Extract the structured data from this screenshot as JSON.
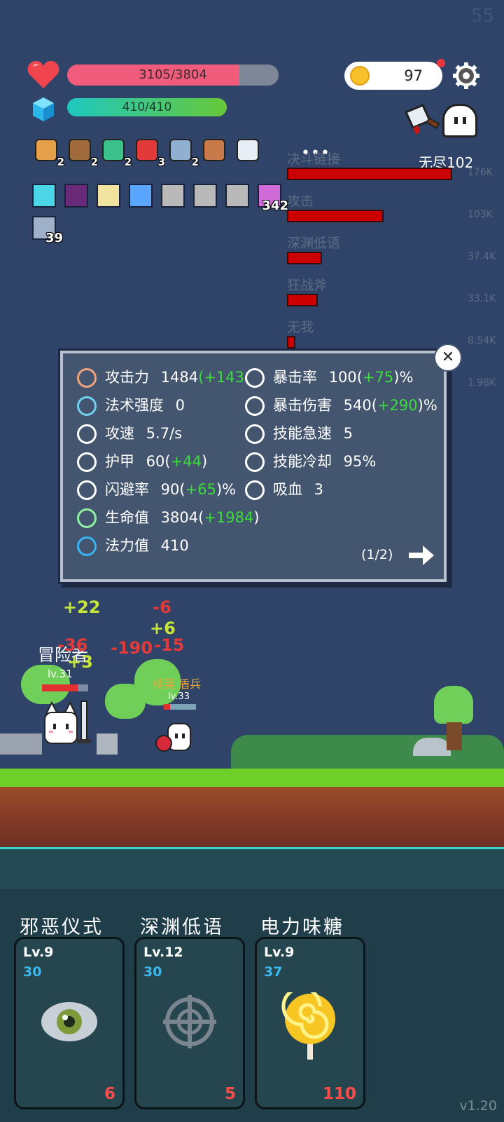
{
  "corner_number": "55",
  "hp": {
    "text": "3105/3804",
    "fraction": 0.816
  },
  "mp": {
    "text": "410/410",
    "fraction": 1.0
  },
  "coins": "97",
  "items_row1": [
    {
      "icon": "book-icon",
      "count": "2"
    },
    {
      "icon": "shield-icon",
      "count": "2"
    },
    {
      "icon": "beads-icon",
      "count": "2"
    },
    {
      "icon": "apple-icon",
      "count": "3"
    },
    {
      "icon": "dagger-icon",
      "count": "2"
    },
    {
      "icon": "potion-icon",
      "count": ""
    },
    {
      "icon": "sword-icon",
      "count": ""
    }
  ],
  "buffs": [
    {
      "icon": "light-buff-icon",
      "color": "#4ad5e8",
      "count": ""
    },
    {
      "icon": "demon-buff-icon",
      "color": "#6a2a7a",
      "count": ""
    },
    {
      "icon": "burst-buff-icon",
      "color": "#f0e3a0",
      "count": ""
    },
    {
      "icon": "star-buff-icon",
      "color": "#5aa6ff",
      "count": ""
    },
    {
      "icon": "armor-buff-icon",
      "color": "#b9b9b9",
      "count": ""
    },
    {
      "icon": "armor-buff-icon",
      "color": "#b9b9b9",
      "count": ""
    },
    {
      "icon": "armor-buff-icon",
      "color": "#b9b9b9",
      "count": ""
    },
    {
      "icon": "crown-buff-icon",
      "color": "#d06ad8",
      "count": "342"
    },
    {
      "icon": "slash-buff-icon",
      "color": "#9fb1c8",
      "count": "39"
    }
  ],
  "damage_stats": {
    "endless_label": "无尽102",
    "rows": [
      {
        "name": "决斗链接",
        "value": "176K",
        "fraction": 1.0
      },
      {
        "name": "攻击",
        "value": "103K",
        "fraction": 0.585
      },
      {
        "name": "深渊低语",
        "value": "37.4K",
        "fraction": 0.212
      },
      {
        "name": "狂战斧",
        "value": "33.1K",
        "fraction": 0.188
      },
      {
        "name": "无我",
        "value": "8.54K",
        "fraction": 0.048
      },
      {
        "name": "",
        "value": "1.98K",
        "fraction": 0.011
      }
    ]
  },
  "stats_panel": {
    "left": [
      {
        "icon": "axe-icon",
        "label": "攻击力",
        "value": "1484",
        "bonus": "(+143",
        "bonus_end": "",
        "suffix": ""
      },
      {
        "icon": "sun-icon",
        "label": "法术强度",
        "value": "0",
        "bonus": "",
        "bonus_end": "",
        "suffix": ""
      },
      {
        "icon": "crosshair-icon",
        "label": "攻速",
        "value": "5.7/s",
        "bonus": "",
        "bonus_end": "",
        "suffix": ""
      },
      {
        "icon": "armor-icon",
        "label": "护甲",
        "value": "60",
        "bonus": "(",
        "bonus_green": "+44",
        "bonus_end": ")",
        "suffix": ""
      },
      {
        "icon": "dodge-icon",
        "label": "闪避率",
        "value": "90",
        "bonus": "(",
        "bonus_green": "+65",
        "bonus_end": ")",
        "suffix": "%"
      },
      {
        "icon": "heart-green-icon",
        "label": "生命值",
        "value": "3804",
        "bonus": "(",
        "bonus_green": "+1984",
        "bonus_end": ")",
        "suffix": ""
      },
      {
        "icon": "mana-icon",
        "label": "法力值",
        "value": "410",
        "bonus": "",
        "bonus_end": "",
        "suffix": ""
      }
    ],
    "right": [
      {
        "icon": "crit-icon",
        "label": "暴击率",
        "value": "100",
        "bonus": "(",
        "bonus_green": "+75",
        "bonus_end": ")",
        "suffix": "%"
      },
      {
        "icon": "crit-damage-icon",
        "label": "暴击伤害",
        "value": "540",
        "bonus": "(",
        "bonus_green": "+290",
        "bonus_end": ")",
        "suffix": "%"
      },
      {
        "icon": "haste-icon",
        "label": "技能急速",
        "value": "5",
        "bonus": "",
        "bonus_end": "",
        "suffix": ""
      },
      {
        "icon": "hourglass-icon",
        "label": "技能冷却",
        "value": "95%",
        "bonus": "",
        "bonus_end": "",
        "suffix": ""
      },
      {
        "icon": "lifesteal-icon",
        "label": "吸血",
        "value": "3",
        "bonus": "",
        "bonus_end": "",
        "suffix": ""
      }
    ],
    "page": "(1/2)"
  },
  "scene": {
    "player_name": "冒险者",
    "player_level": "lv.31",
    "enemy_name": "精英 盾兵",
    "enemy_level": "lv.33",
    "float_numbers": [
      {
        "text": "+22",
        "color": "#c8e63a"
      },
      {
        "text": "-6",
        "color": "#e23a3a"
      },
      {
        "text": "+6",
        "color": "#c8e63a"
      },
      {
        "text": "-190",
        "color": "#e23a3a"
      },
      {
        "text": "-15",
        "color": "#e23a3a"
      },
      {
        "text": "-36",
        "color": "#e23a3a"
      },
      {
        "text": "+3",
        "color": "#c8e63a"
      }
    ]
  },
  "skills": [
    {
      "title": "邪恶仪式",
      "level": "Lv.9",
      "blue": "30",
      "cost": "6",
      "icon": "eye-icon"
    },
    {
      "title": "深渊低语",
      "level": "Lv.12",
      "blue": "30",
      "cost": "5",
      "icon": "target-icon"
    },
    {
      "title": "电力味糖",
      "level": "Lv.9",
      "blue": "37",
      "cost": "110",
      "icon": "lollipop-icon"
    }
  ],
  "version": "v1.20"
}
